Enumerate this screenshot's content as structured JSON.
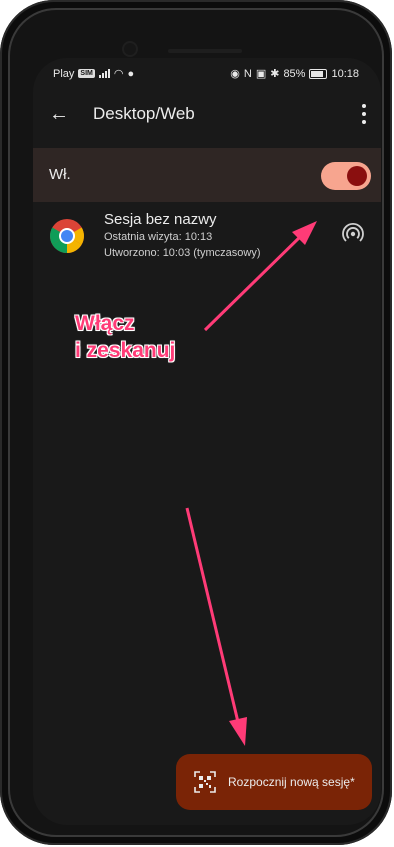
{
  "status_bar": {
    "left_badge_play": "Play",
    "left_badge_small": "SIM",
    "battery": "85%",
    "time": "10:18"
  },
  "app_bar": {
    "title": "Desktop/Web"
  },
  "toggle": {
    "label": "Wł.",
    "on": true
  },
  "session": {
    "title": "Sesja bez nazwy",
    "last_visit": "Ostatnia wizyta: 10:13",
    "created": "Utworzono: 10:03 (tymczasowy)"
  },
  "annotation": {
    "line1": "Włącz",
    "line2": "i zeskanuj"
  },
  "fab": {
    "label": "Rozpocznij nową sesję*"
  },
  "colors": {
    "accent_arrow": "#ff3b77",
    "toggle_track": "#f7a58f",
    "toggle_knob": "#8a0f0f",
    "fab_bg": "#7a2406"
  }
}
